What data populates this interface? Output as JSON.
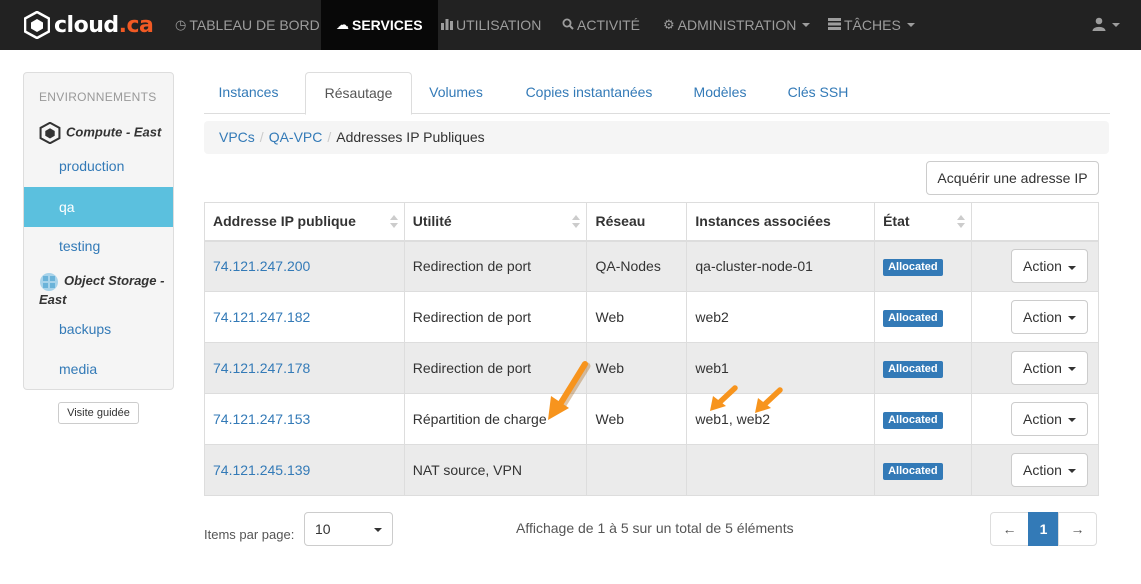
{
  "brand": {
    "name": "cloud",
    "tld": ".ca"
  },
  "nav": {
    "items": [
      {
        "label": "TABLEAU DE BORD",
        "icon": "dashboard-icon"
      },
      {
        "label": "SERVICES",
        "icon": "cloud-icon"
      },
      {
        "label": "UTILISATION",
        "icon": "bar-chart-icon"
      },
      {
        "label": "ACTIVITÉ",
        "icon": "search-icon"
      },
      {
        "label": "ADMINISTRATION",
        "icon": "gear-icon"
      },
      {
        "label": "TÂCHES",
        "icon": "tasks-icon"
      }
    ],
    "user_icon": "user-icon"
  },
  "sidebar": {
    "heading": "ENVIRONNEMENTS",
    "groups": [
      {
        "label": "Compute - East",
        "icon": "compute-cube-icon"
      },
      {
        "label_line1": "Object Storage -",
        "label_line2": "East",
        "icon": "object-storage-icon"
      }
    ],
    "items": [
      {
        "label": "production"
      },
      {
        "label": "qa",
        "active": true
      },
      {
        "label": "testing"
      },
      {
        "label": "backups"
      },
      {
        "label": "media"
      }
    ],
    "tour_button": "Visite guidée"
  },
  "tabs": [
    {
      "label": "Instances"
    },
    {
      "label": "Résautage",
      "active": true
    },
    {
      "label": "Volumes"
    },
    {
      "label": "Copies instantanées"
    },
    {
      "label": "Modèles"
    },
    {
      "label": "Clés SSH"
    }
  ],
  "breadcrumb": {
    "items": [
      "VPCs",
      "QA-VPC"
    ],
    "current": "Addresses IP Publiques"
  },
  "acquire_button": "Acquérir une adresse IP",
  "table": {
    "headers": [
      "Addresse IP publique",
      "Utilité",
      "Réseau",
      "Instances associées",
      "État",
      ""
    ],
    "rows": [
      {
        "ip": "74.121.247.200",
        "purpose": "Redirection de port",
        "network": "QA-Nodes",
        "instances": "qa-cluster-node-01",
        "state": "Allocated",
        "action": "Action"
      },
      {
        "ip": "74.121.247.182",
        "purpose": "Redirection de port",
        "network": "Web",
        "instances": "web2",
        "state": "Allocated",
        "action": "Action"
      },
      {
        "ip": "74.121.247.178",
        "purpose": "Redirection de port",
        "network": "Web",
        "instances": "web1",
        "state": "Allocated",
        "action": "Action"
      },
      {
        "ip": "74.121.247.153",
        "purpose": "Répartition de charge",
        "network": "Web",
        "instances": "web1, web2",
        "state": "Allocated",
        "action": "Action"
      },
      {
        "ip": "74.121.245.139",
        "purpose": "NAT source, VPN",
        "network": "",
        "instances": "",
        "state": "Allocated",
        "action": "Action"
      }
    ]
  },
  "footer": {
    "items_label": "Items par page:",
    "page_size": "10",
    "summary": "Affichage de 1 à 5 sur un total de 5 éléments",
    "pager": {
      "prev": "←",
      "current": "1",
      "next": "→"
    }
  },
  "colors": {
    "navbar": "#222222",
    "link": "#337ab7",
    "sidebar_active": "#5bc0de",
    "arrow": "#f7941d",
    "brand_accent": "#f15a24"
  }
}
